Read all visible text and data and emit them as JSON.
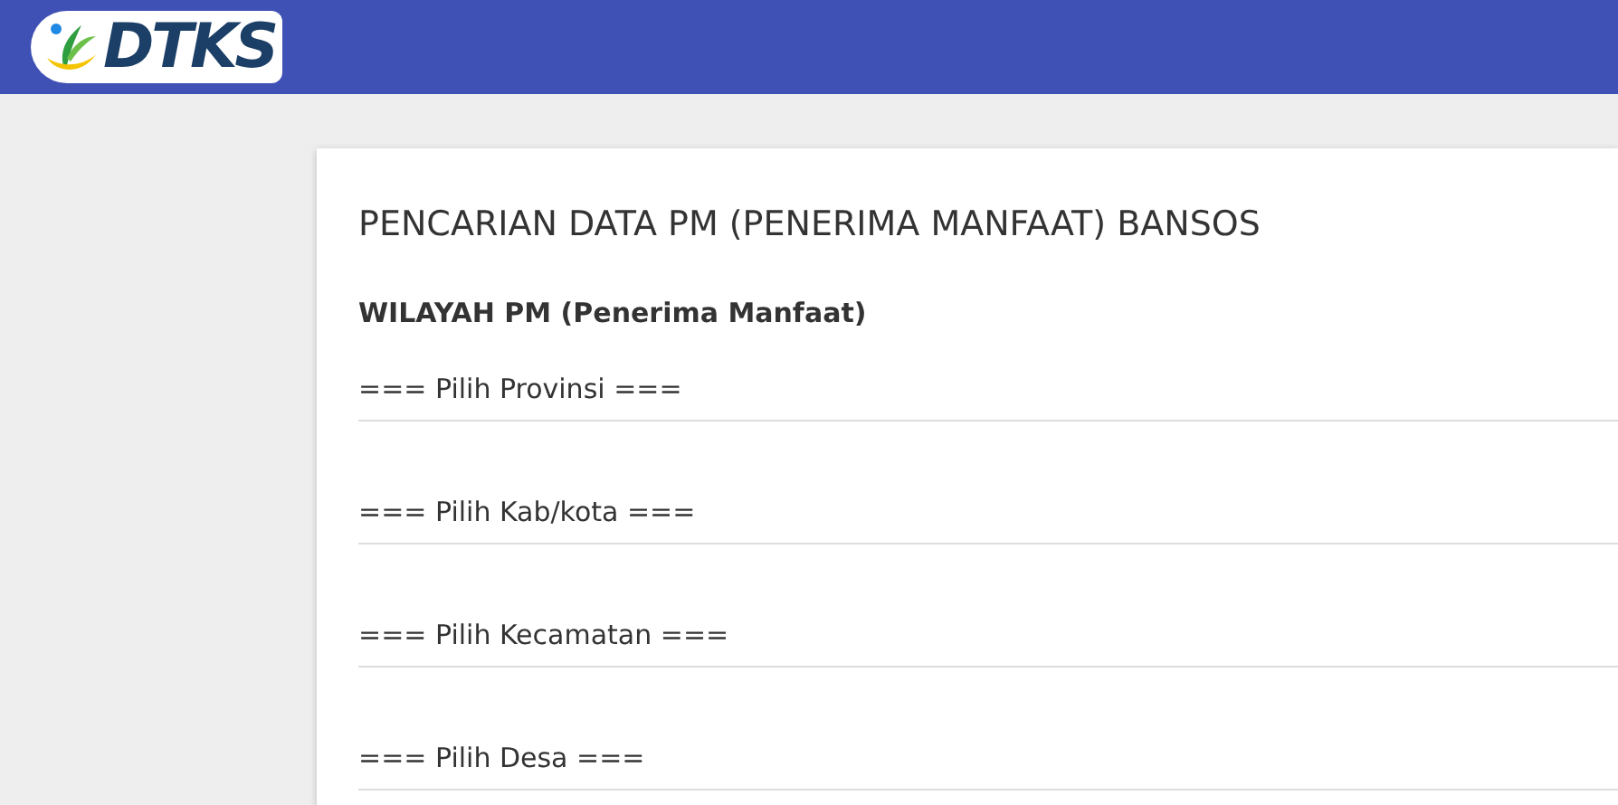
{
  "header": {
    "logo_text": "DTKS"
  },
  "card": {
    "title": "PENCARIAN DATA PM (PENERIMA MANFAAT) BANSOS",
    "section_title": "WILAYAH PM (Penerima Manfaat)",
    "selects": [
      {
        "placeholder": "=== Pilih Provinsi ==="
      },
      {
        "placeholder": "=== Pilih Kab/kota ==="
      },
      {
        "placeholder": "=== Pilih Kecamatan ==="
      },
      {
        "placeholder": "=== Pilih Desa ==="
      }
    ]
  }
}
